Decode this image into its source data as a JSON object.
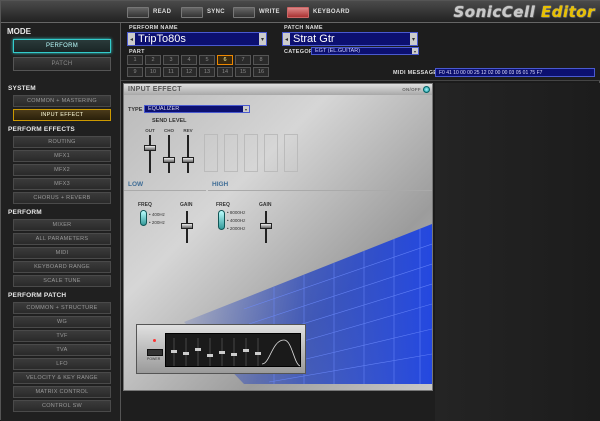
{
  "topbar": {
    "buttons": [
      {
        "label": "READ"
      },
      {
        "label": "SYNC"
      },
      {
        "label": "WRITE"
      },
      {
        "label": "KEYBOARD"
      }
    ],
    "brand_main": "SonicCell",
    "brand_accent": "Editor"
  },
  "mode": {
    "heading": "MODE",
    "perform": "PERFORM",
    "patch": "PATCH"
  },
  "nav": {
    "system_heading": "SYSTEM",
    "system": [
      "COMMON + MASTERING",
      "INPUT EFFECT"
    ],
    "perform_effects_heading": "PERFORM EFFECTS",
    "perform_effects": [
      "ROUTING",
      "MFX1",
      "MFX2",
      "MFX3",
      "CHORUS + REVERB"
    ],
    "perform_heading": "PERFORM",
    "perform": [
      "MIXER",
      "ALL PARAMETERS",
      "MIDI",
      "KEYBOARD RANGE",
      "SCALE TUNE"
    ],
    "perform_patch_heading": "PERFORM PATCH",
    "perform_patch": [
      "COMMON + STRUCTURE",
      "WG",
      "TVF",
      "TVA",
      "LFO",
      "VELOCITY & KEY RANGE",
      "MATRIX CONTROL",
      "CONTROL SW"
    ]
  },
  "header": {
    "perform_name_label": "PERFORM NAME",
    "perform_name": "TripTo80s",
    "patch_name_label": "PATCH NAME",
    "patch_name": "Strat Gtr",
    "part_label": "PART",
    "parts": [
      "1",
      "2",
      "3",
      "4",
      "5",
      "6",
      "7",
      "8",
      "9",
      "10",
      "11",
      "12",
      "13",
      "14",
      "15",
      "16"
    ],
    "selected_part": "6",
    "category_label": "CATEGORY",
    "category": "EGT (EL.GUITAR)",
    "midi_message_label": "MIDI MESSAGE",
    "midi_message": "F0 41 10 00 00 25 12 02 00 00 03 05 01 75 F7"
  },
  "input_effect": {
    "title": "INPUT EFFECT",
    "onoff_label": "ON/OFF",
    "type_label": "TYPE",
    "type_value": "EQUALIZER",
    "send_level_label": "SEND LEVEL",
    "send_columns": [
      "OUT",
      "CHO",
      "REV"
    ],
    "send_levels_pct": [
      70,
      30,
      30
    ],
    "low": {
      "label": "LOW",
      "freq_label": "FREQ",
      "freq_options": [
        "400Hz",
        "200Hz"
      ],
      "gain_label": "GAIN",
      "gain_pct": 55
    },
    "high": {
      "label": "HIGH",
      "freq_label": "FREQ",
      "freq_options": [
        "8000Hz",
        "4000Hz",
        "2000Hz"
      ],
      "gain_label": "GAIN",
      "gain_pct": 55
    },
    "device_button_label": "POWER"
  },
  "colors": {
    "accent_cyan": "#33cccc",
    "selected_orange": "#cc9900",
    "lcd_blue": "#0c1070"
  }
}
